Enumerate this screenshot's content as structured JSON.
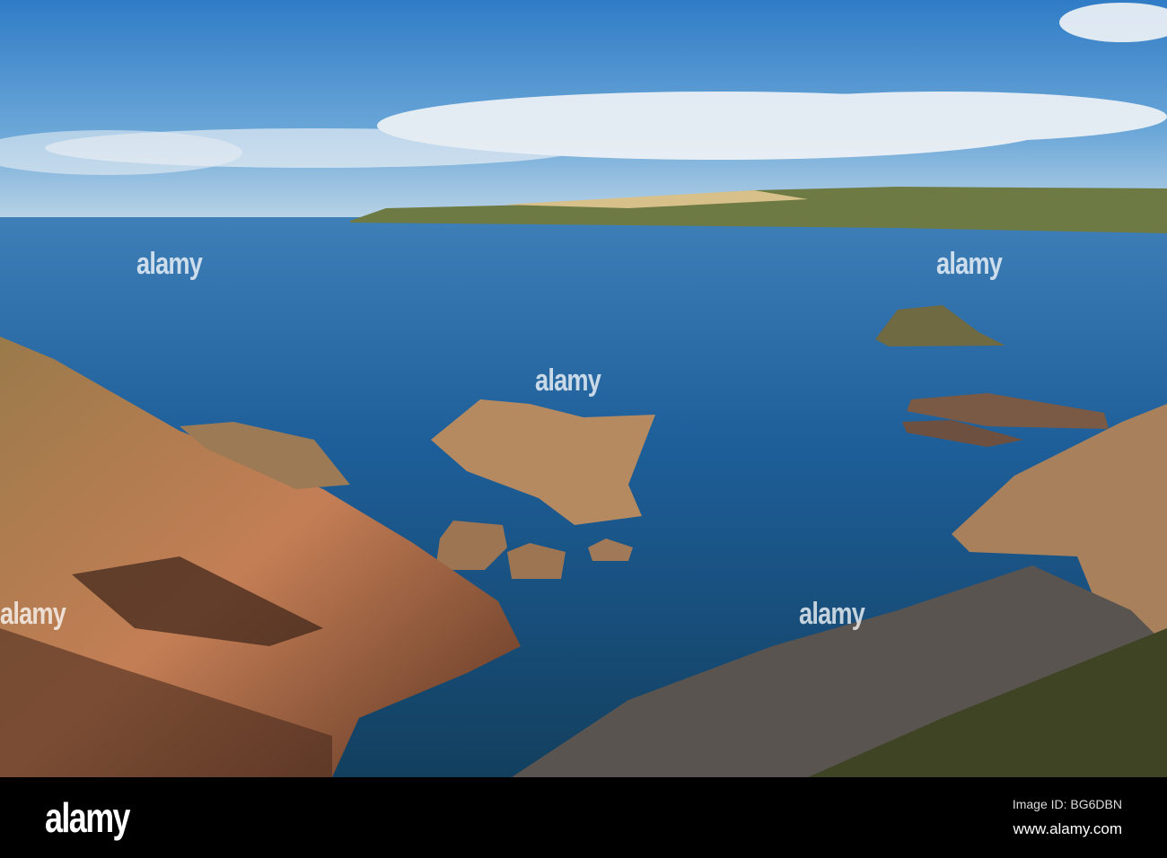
{
  "watermark": "alamy",
  "footer": {
    "logo": "alamy",
    "image_id": "Image ID: BG6DBN",
    "website": "www.alamy.com"
  },
  "colors": {
    "sky": "#3f86c8",
    "sea": "#1f5f98",
    "rock": "#b87a52",
    "footer": "#000000"
  }
}
